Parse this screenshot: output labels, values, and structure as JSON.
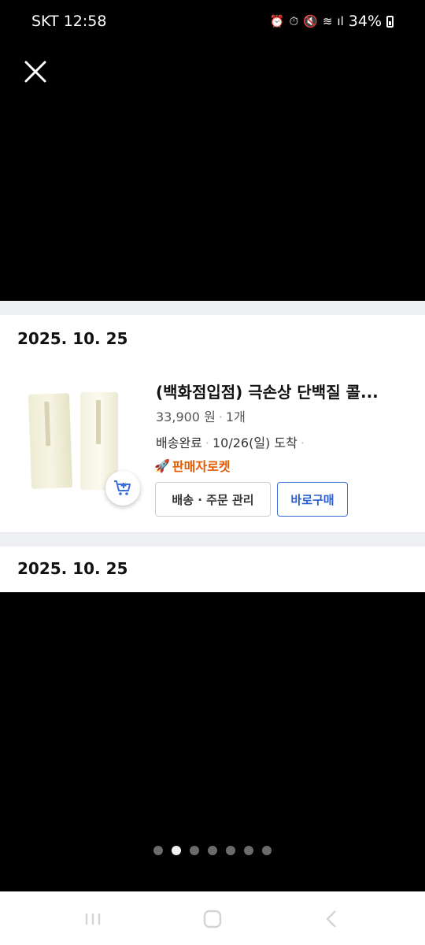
{
  "status_bar": {
    "carrier_time": "SKT 12:58",
    "icons": [
      "alarm-app-icon",
      "alarm-clock-icon",
      "mute-icon",
      "wifi-icon",
      "signal-icon"
    ],
    "battery": "34%"
  },
  "toolbar": {
    "close_icon": "close-icon"
  },
  "orders": [
    {
      "date": "2025. 10. 25",
      "product_title": "(백화점입점) 극손상 단백질 콜...",
      "price": "33,900 원",
      "quantity": "1개",
      "delivery_status": "배송완료",
      "arrival": "10/26(일) 도착",
      "seller_badge": "판매자로켓",
      "manage_label": "배송 · 주문 관리",
      "buy_again_label": "바로구매"
    },
    {
      "date": "2025. 10. 25"
    }
  ],
  "pager": {
    "total": 7,
    "active_index": 1
  },
  "colors": {
    "accent_blue": "#2a5fd0",
    "seller_orange": "#e35a00"
  }
}
